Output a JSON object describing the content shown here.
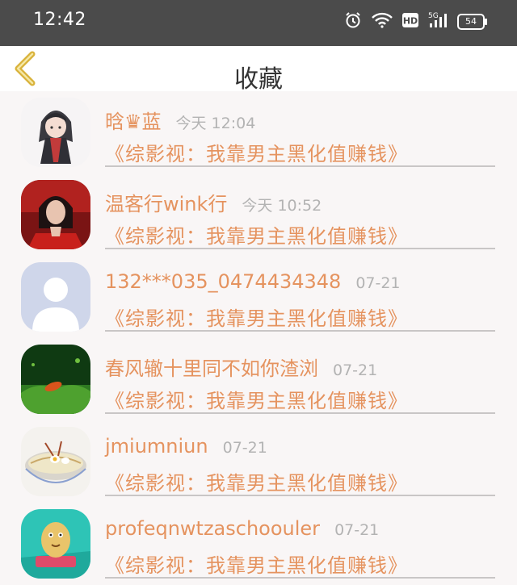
{
  "status_bar": {
    "time": "12:42",
    "network": "5G",
    "hd_label": "HD",
    "battery": "54"
  },
  "nav": {
    "title": "收藏"
  },
  "items": [
    {
      "name": "晗♛蓝",
      "time": "今天 12:04",
      "book": "《综影视：我靠男主黑化值赚钱》",
      "avatar": "anime-character-avatar"
    },
    {
      "name": "温客行wink行",
      "time": "今天 10:52",
      "book": "《综影视：我靠男主黑化值赚钱》",
      "avatar": "red-costume-avatar"
    },
    {
      "name": "132***035_0474434348",
      "time": "07-21",
      "book": "《综影视：我靠男主黑化值赚钱》",
      "avatar": "default-user-avatar"
    },
    {
      "name": "春风辙十里同不如你渣浏",
      "time": "07-21",
      "book": "《综影视：我靠男主黑化值赚钱》",
      "avatar": "green-grass-avatar"
    },
    {
      "name": "jmiumniun",
      "time": "07-21",
      "book": "《综影视：我靠男主黑化值赚钱》",
      "avatar": "noodle-bowl-avatar"
    },
    {
      "name": "profeqnwtzaschoouler",
      "time": "07-21",
      "book": "《综影视：我靠男主黑化值赚钱》",
      "avatar": "cartoon-potato-avatar"
    }
  ],
  "colors": {
    "accent": "#e5935f",
    "status_bar": "#4b4b4b",
    "back_arrow": "#d9b23a"
  }
}
